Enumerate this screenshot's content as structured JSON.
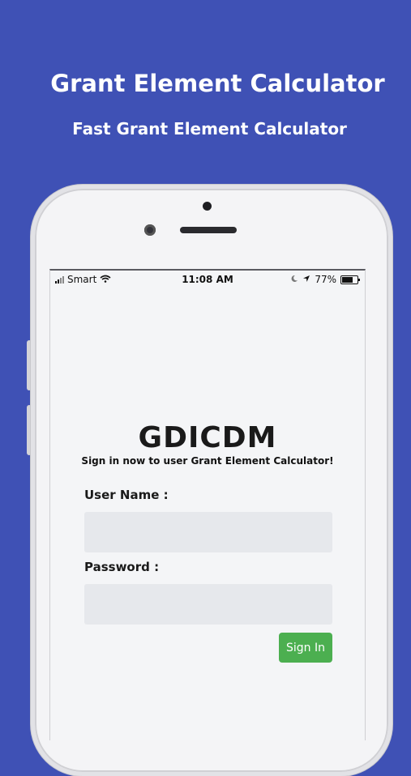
{
  "header": {
    "title": "Grant Element Calculator",
    "subtitle": "Fast Grant Element Calculator"
  },
  "status_bar": {
    "carrier": "Smart",
    "time": "11:08 AM",
    "battery": "77%",
    "battery_level": 0.77,
    "icons": [
      "signal-icon",
      "wifi-icon",
      "moon-icon",
      "location-arrow-icon",
      "battery-icon"
    ]
  },
  "login": {
    "app_name": "GDICDM",
    "tagline": "Sign in now to user Grant Element Calculator!",
    "username_label": "User Name :",
    "username_value": "",
    "password_label": "Password :",
    "password_value": "",
    "signin_label": "Sign In"
  },
  "colors": {
    "background": "#3f51b5",
    "button": "#4caf50",
    "input": "#e6e8ec"
  }
}
